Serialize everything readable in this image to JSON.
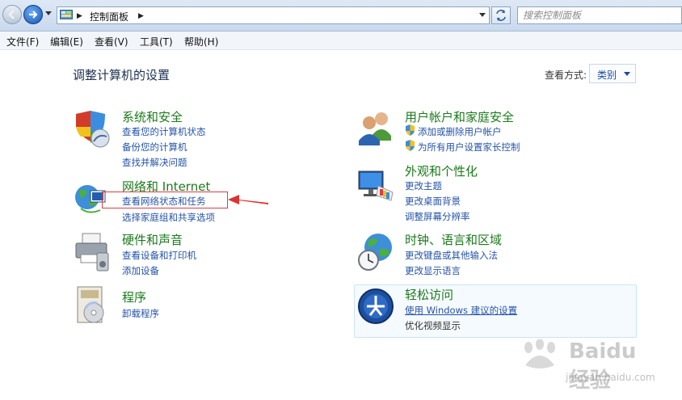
{
  "address_bar": {
    "breadcrumb": [
      "控制面板"
    ],
    "search_placeholder": "搜索控制面板"
  },
  "menu": [
    "文件(F)",
    "编辑(E)",
    "查看(V)",
    "工具(T)",
    "帮助(H)"
  ],
  "page": {
    "title": "调整计算机的设置",
    "view_by_label": "查看方式:",
    "view_by_value": "类别"
  },
  "categories": [
    {
      "title": "系统和安全",
      "icon": "shield-icon",
      "links": [
        "查看您的计算机状态",
        "备份您的计算机",
        "查找并解决问题"
      ]
    },
    {
      "title": "网络和 Internet",
      "icon": "network-globe-icon",
      "links": [
        "查看网络状态和任务",
        "选择家庭组和共享选项"
      ]
    },
    {
      "title": "硬件和声音",
      "icon": "printer-icon",
      "links": [
        "查看设备和打印机",
        "添加设备"
      ]
    },
    {
      "title": "程序",
      "icon": "programs-icon",
      "links": [
        "卸载程序"
      ]
    },
    {
      "title": "用户帐户和家庭安全",
      "icon": "users-icon",
      "links": [
        "添加或删除用户帐户",
        "为所有用户设置家长控制"
      ]
    },
    {
      "title": "外观和个性化",
      "icon": "monitor-palette-icon",
      "links": [
        "更改主题",
        "更改桌面背景",
        "调整屏幕分辨率"
      ]
    },
    {
      "title": "时钟、语言和区域",
      "icon": "clock-globe-icon",
      "links": [
        "更改键盘或其他输入法",
        "更改显示语言"
      ]
    },
    {
      "title": "轻松访问",
      "icon": "ease-of-access-icon",
      "links": [
        "使用 Windows 建议的设置",
        "优化视频显示"
      ]
    }
  ],
  "watermark": {
    "brand": "Baidu 经验",
    "url": "jingyan.baidu.com"
  }
}
